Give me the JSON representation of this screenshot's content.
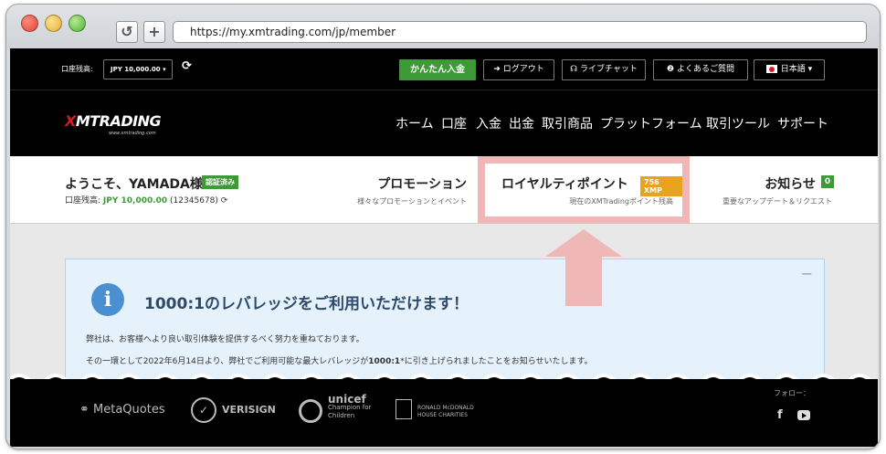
{
  "browser": {
    "url": "https://my.xmtrading.com/jp/member",
    "refresh_glyph": "↺",
    "newtab_glyph": "+"
  },
  "topbar": {
    "balance_label": "口座残高:",
    "account_select": "JPY 10,000.00 ▾",
    "refresh_glyph": "⟳",
    "deposit_label": "かんたん入金",
    "logout_label": "➜ ログアウト",
    "chat_label": "☊ ライブチャット",
    "faq_label": "❷ よくあるご質問",
    "lang_label": "日本語 ▾"
  },
  "navbar": {
    "logo_x": "X",
    "logo_text": "MTRADING",
    "logo_sub": "www.xmtrading.com",
    "items": [
      "ホーム",
      "口座",
      "入金",
      "出金",
      "取引商品",
      "プラットフォーム",
      "取引ツール",
      "サポート"
    ]
  },
  "infobar": {
    "welcome": "ようこそ、YAMADA様 ▾",
    "verified": "認証済み",
    "balance_prefix": "口座残高: ",
    "balance_amount": "JPY 10,000.00",
    "balance_suffix": " (12345678) ⟳",
    "promo_title": "プロモーション",
    "promo_sub": "様々なプロモーションとイベント",
    "royalty_title": "ロイヤルティポイント",
    "xmp_badge": "756 XMP",
    "royalty_sub": "現在のXMTradingポイント残高",
    "news_title": "お知らせ",
    "news_count": "0",
    "news_sub": "重要なアップデート＆リクエスト"
  },
  "banner": {
    "icon": "i",
    "title": "1000:1のレバレッジをご利用いただけます！",
    "p1": "弊社は、お客様へより良い取引体験を提供するべく努力を重ねております。",
    "p2_pre": "その一環として2022年6月14日より、弊社でご利用可能な最大レバレッジが",
    "p2_bold": "1000:1",
    "p2_post": "*に引き上げられましたことをお知らせいたします。",
    "minimize": "−"
  },
  "footer": {
    "metaquotes": "MetaQuotes",
    "verisign": "VERISIGN",
    "unicef_big": "unicef",
    "unicef_small": "Champion for Children",
    "rm_text": "RONALD McDONALD HOUSE CHARITIES",
    "follow": "フォロー：",
    "facebook": "f"
  },
  "colors": {
    "green": "#3e9a37",
    "highlight": "#efb7b5",
    "xmp_badge": "#e8a21e",
    "banner_bg": "#e6f2fb"
  }
}
